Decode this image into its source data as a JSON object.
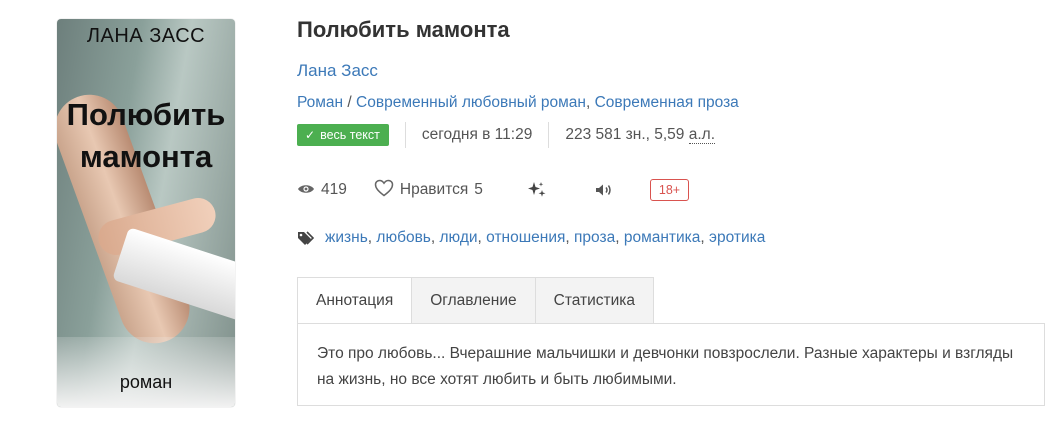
{
  "cover": {
    "author": "ЛАНА ЗАСС",
    "title": "Полюбить мамонта",
    "genre": "роман"
  },
  "book": {
    "title": "Полюбить мамонта",
    "author": "Лана Засс",
    "genres": [
      {
        "label": "Роман"
      },
      {
        "label": "Современный любовный роман"
      },
      {
        "label": "Современная проза"
      }
    ],
    "genre_separator_1": " / ",
    "genre_separator_2": ", "
  },
  "meta": {
    "status_badge": "весь текст",
    "updated": "сегодня в 11:29",
    "chars_prefix": "223 581 зн., 5,59 ",
    "chars_unit": "а.л."
  },
  "stats": {
    "views": "419",
    "likes_label": "Нравится",
    "likes_count": "5",
    "age_rating": "18+"
  },
  "tags": [
    "жизнь",
    "любовь",
    "люди",
    "отношения",
    "проза",
    "романтика",
    "эротика"
  ],
  "tabs": [
    {
      "label": "Аннотация"
    },
    {
      "label": "Оглавление"
    },
    {
      "label": "Статистика"
    }
  ],
  "annotation": "Это про любовь... Вчерашние мальчишки и девчонки повзрослели. Разные характеры и взгляды на жизнь, но все хотят любить и быть любимыми.",
  "colors": {
    "link": "#3c79b8",
    "badge_green": "#4caf50",
    "age_red": "#d9534f"
  },
  "icons": [
    "check-icon",
    "eye-icon",
    "heart-icon",
    "sparkle-icon",
    "speaker-icon",
    "tag-icon"
  ]
}
